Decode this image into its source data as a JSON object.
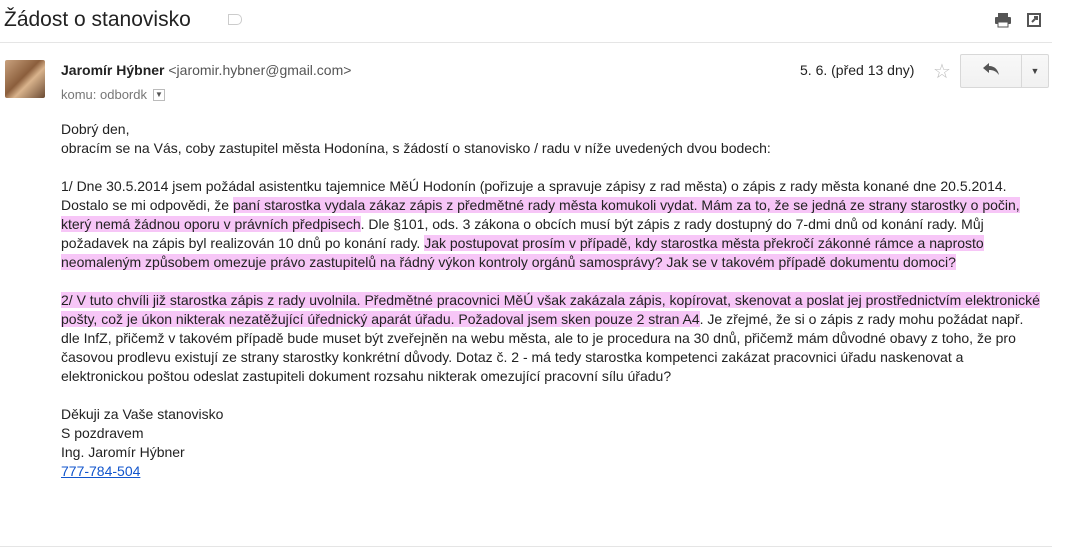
{
  "email": {
    "subject": "Žádost o stanovisko",
    "sender_name": "Jaromír Hýbner",
    "sender_email": "<jaromir.hybner@gmail.com>",
    "to": "komu: odbordk",
    "date": "5. 6. (před 13 dny)"
  },
  "icons": {
    "print": "print-icon",
    "new_window": "open-in-new-window-icon",
    "star": "star-icon",
    "reply": "reply-icon",
    "more": "chevron-down-icon"
  },
  "body": {
    "greeting": "Dobrý den,",
    "intro": "obracím se na Vás, coby zastupitel města Hodonína, s žádostí o stanovisko / radu v níže uvedených dvou bodech:",
    "p1_a": "1/ Dne 30.5.2014 jsem požádal asistentku tajemnice MěÚ Hodonín (pořizuje a spravuje zápisy z rad města) o zápis z rady města konané dne 20.5.2014. Dostalo se mi odpovědi, že ",
    "p1_hl1": "paní starostka vydala zákaz zápis z předmětné rady města komukoli vydat. Mám za to, že se jedná ze strany starostky o počin, který nemá žádnou oporu v právních předpisech",
    "p1_b": ". Dle §101, ods. 3 zákona o obcích musí být zápis z rady dostupný do 7-dmi dnů od konání rady. Můj požadavek na zápis byl realizován 10 dnů po konání rady. ",
    "p1_hl2": "Jak postupovat prosím v případě, kdy starostka města překročí zákonné rámce a naprosto neomaleným způsobem omezuje právo zastupitelů na řádný výkon kontroly orgánů samosprávy? Jak se v takovém případě dokumentu domoci?",
    "p2_hl": "2/ V tuto chvíli již starostka zápis z rady uvolnila. Předmětné pracovnici MěÚ však zakázala zápis, kopírovat, skenovat a poslat jej prostřednictvím elektronické pošty, což je úkon nikterak nezatěžující úřednický aparát úřadu. Požadoval jsem sken pouze 2 stran A4",
    "p2_rest": ". Je zřejmé, že si o zápis z rady mohu požádat např. dle InfZ, přičemž v takovém případě bude muset být zveřejněn na webu města, ale to je procedura na 30 dnů, přičemž mám důvodné obavy z toho, že pro časovou prodlevu existují ze strany starostky konkrétní důvody. Dotaz č. 2 - má tedy starostka kompetenci zakázat pracovnici úřadu naskenovat a elektronickou poštou odeslat zastupiteli dokument rozsahu nikterak omezující pracovní sílu úřadu?",
    "thanks": "Děkuji za Vaše stanovisko",
    "regards": "S pozdravem",
    "signature": "Ing. Jaromír Hýbner",
    "phone": "777-784-504"
  },
  "colors": {
    "highlight": "#f7c6f7",
    "link": "#1155cc"
  }
}
